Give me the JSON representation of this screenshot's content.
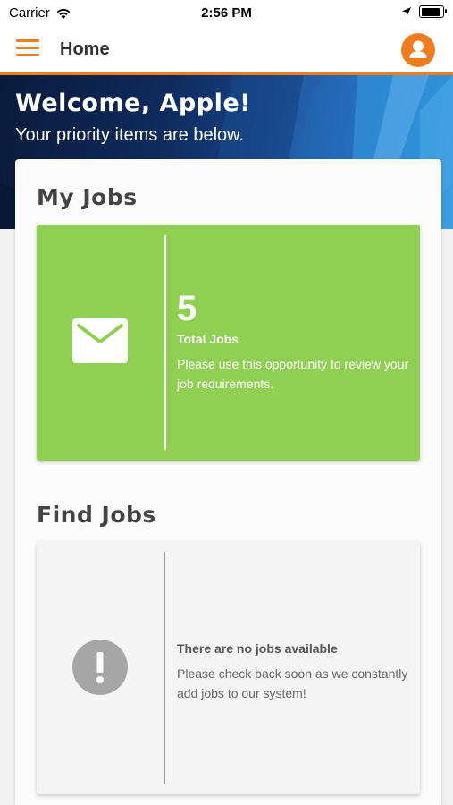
{
  "status_bar": {
    "carrier": "Carrier",
    "time": "2:56 PM"
  },
  "nav": {
    "title": "Home",
    "accent_color": "#f07c1e"
  },
  "hero": {
    "title": "Welcome, Apple!",
    "subtitle": "Your priority items are below."
  },
  "my_jobs": {
    "section_title": "My Jobs",
    "count": "5",
    "label": "Total Jobs",
    "description": "Please use this opportunity to review your job requirements.",
    "tile_color": "#8fd052",
    "icon": "envelope-icon"
  },
  "find_jobs": {
    "section_title": "Find Jobs",
    "empty_title": "There are no jobs available",
    "empty_description": "Please check back soon as we constantly add jobs to our system!",
    "icon": "exclamation-circle-icon"
  }
}
